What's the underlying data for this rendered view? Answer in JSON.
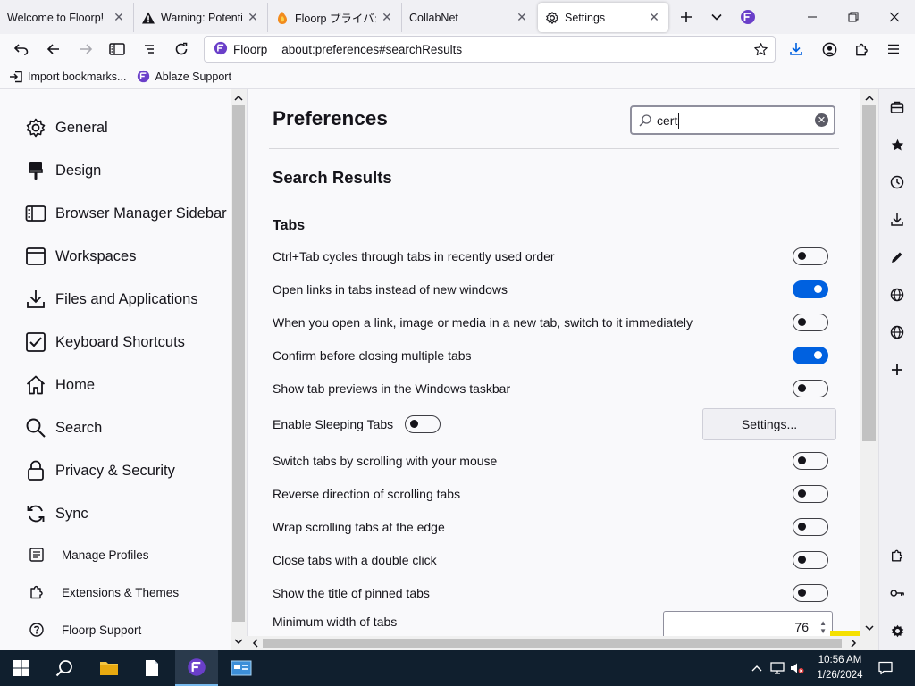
{
  "tabs": [
    {
      "title": "Welcome to Floorp!",
      "icon": "floorp-logo-icon"
    },
    {
      "title": "Warning: Potential Security Risk",
      "icon": "warning-icon"
    },
    {
      "title": "Floorp プライバシーポリシー",
      "icon": "floorp-fox-icon"
    },
    {
      "title": "CollabNet",
      "icon": ""
    },
    {
      "title": "Settings",
      "icon": "gear-icon"
    }
  ],
  "navbar": {
    "brand": "Floorp",
    "url": "about:preferences#searchResults"
  },
  "bookmarks": [
    {
      "label": "Import bookmarks...",
      "icon": "import-icon"
    },
    {
      "label": "Ablaze Support",
      "icon": "floorp-logo-icon"
    }
  ],
  "sidebar": {
    "categories": [
      {
        "label": "General",
        "icon": "gear-icon"
      },
      {
        "label": "Design",
        "icon": "paintbrush-icon"
      },
      {
        "label": "Browser Manager Sidebar",
        "icon": "sidebar-icon"
      },
      {
        "label": "Workspaces",
        "icon": "window-icon"
      },
      {
        "label": "Files and Applications",
        "icon": "download-icon"
      },
      {
        "label": "Keyboard Shortcuts",
        "icon": "checkbox-icon"
      },
      {
        "label": "Home",
        "icon": "home-icon"
      },
      {
        "label": "Search",
        "icon": "search-icon"
      },
      {
        "label": "Privacy & Security",
        "icon": "lock-icon"
      },
      {
        "label": "Sync",
        "icon": "sync-icon"
      }
    ],
    "footer": [
      {
        "label": "Manage Profiles",
        "icon": "profiles-icon"
      },
      {
        "label": "Extensions & Themes",
        "icon": "puzzle-icon"
      },
      {
        "label": "Floorp Support",
        "icon": "help-icon"
      }
    ]
  },
  "main": {
    "title": "Preferences",
    "search_value": "cert",
    "results_heading": "Search Results",
    "section": "Tabs",
    "rows": [
      {
        "label": "Ctrl+Tab cycles through tabs in recently used order",
        "on": false
      },
      {
        "label": "Open links in tabs instead of new windows",
        "on": true
      },
      {
        "label": "When you open a link, image or media in a new tab, switch to it immediately",
        "on": false
      },
      {
        "label": "Confirm before closing multiple tabs",
        "on": true
      },
      {
        "label": "Show tab previews in the Windows taskbar",
        "on": false
      },
      {
        "label": "Enable Sleeping Tabs",
        "on": false
      },
      {
        "label": "Switch tabs by scrolling with your mouse",
        "on": false
      },
      {
        "label": "Reverse direction of scrolling tabs",
        "on": false
      },
      {
        "label": "Wrap scrolling tabs at the edge",
        "on": false
      },
      {
        "label": "Close tabs with a double click",
        "on": false
      },
      {
        "label": "Show the title of pinned tabs",
        "on": false
      },
      {
        "label": "Minimum width of tabs"
      }
    ],
    "settings_button": "Settings...",
    "min_width_value": "76"
  },
  "taskbar": {
    "time": "10:56 AM",
    "date": "1/26/2024"
  }
}
